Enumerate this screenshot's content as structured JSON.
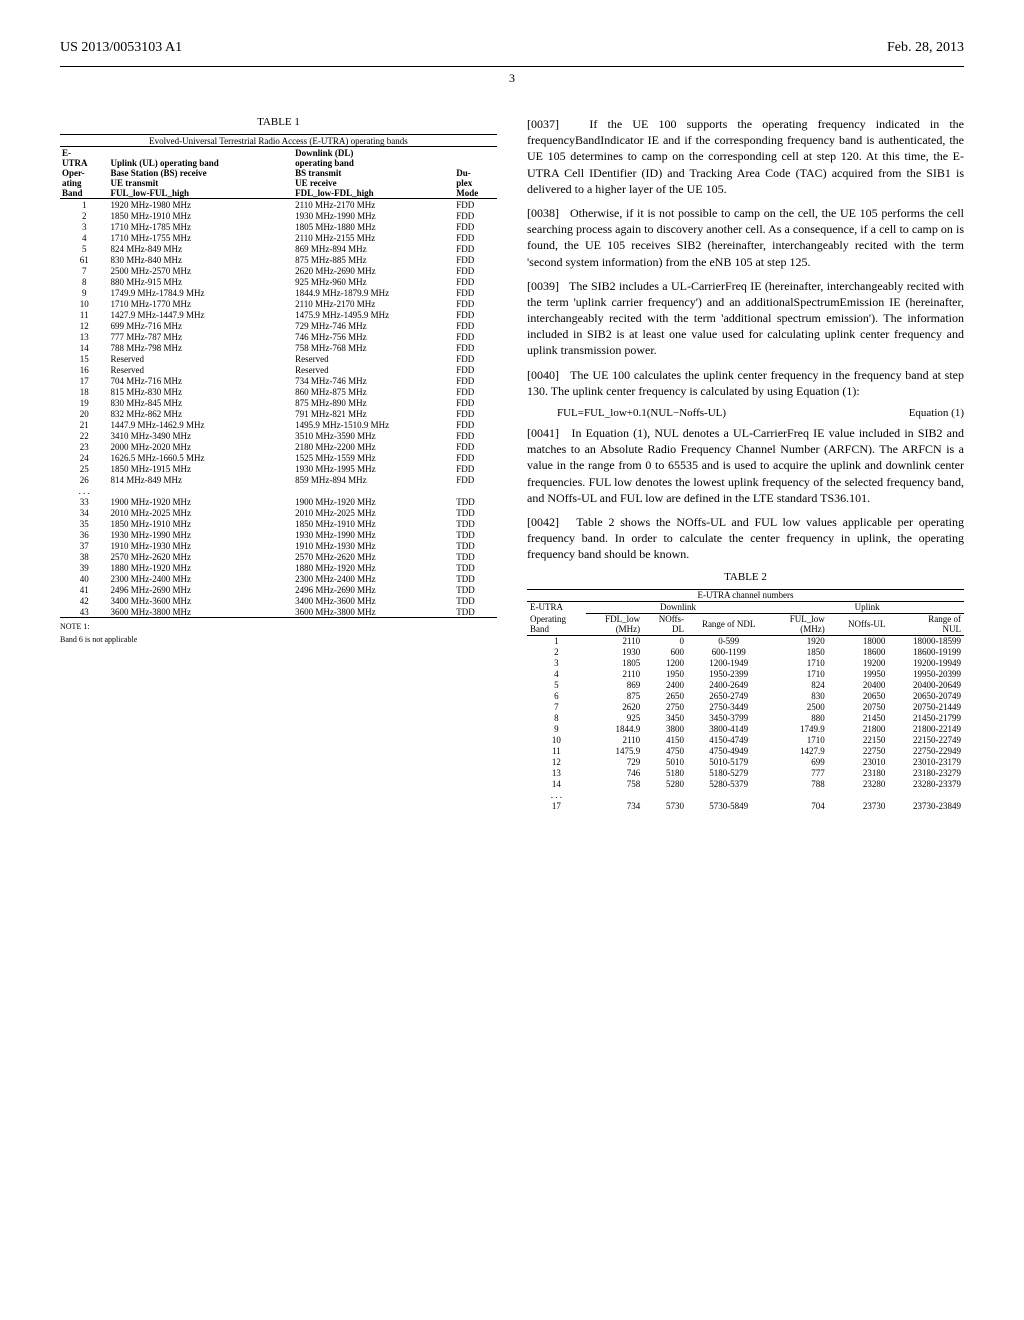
{
  "header": {
    "left": "US 2013/0053103 A1",
    "right": "Feb. 28, 2013"
  },
  "page_number": "3",
  "table1": {
    "title": "TABLE 1",
    "caption": "Evolved-Universal Terrestrial Radio Access (E-UTRA) operating bands",
    "headers": {
      "col1_l1": "E-",
      "col1_l2": "UTRA",
      "col1_l3": "Oper-",
      "col1_l4": "ating",
      "col1_l5": "Band",
      "col2_l1": "Uplink (UL) operating band",
      "col2_l2": "Base Station (BS) receive",
      "col2_l3": "UE transmit",
      "col2_l4": "FUL_low-FUL_high",
      "col3_l1": "Downlink (DL)",
      "col3_l2": "operating band",
      "col3_l3": "BS transmit",
      "col3_l4": "UE receive",
      "col3_l5": "FDL_low-FDL_high",
      "col4_l1": "Du-",
      "col4_l2": "plex",
      "col4_l3": "Mode"
    },
    "rows": [
      {
        "band": "1",
        "ul": "1920 MHz-1980 MHz",
        "dl": "2110 MHz-2170 MHz",
        "mode": "FDD"
      },
      {
        "band": "2",
        "ul": "1850 MHz-1910 MHz",
        "dl": "1930 MHz-1990 MHz",
        "mode": "FDD"
      },
      {
        "band": "3",
        "ul": "1710 MHz-1785 MHz",
        "dl": "1805 MHz-1880 MHz",
        "mode": "FDD"
      },
      {
        "band": "4",
        "ul": "1710 MHz-1755 MHz",
        "dl": "2110 MHz-2155 MHz",
        "mode": "FDD"
      },
      {
        "band": "5",
        "ul": "824 MHz-849 MHz",
        "dl": "869 MHz-894 MHz",
        "mode": "FDD"
      },
      {
        "band": "61",
        "ul": "830 MHz-840 MHz",
        "dl": "875 MHz-885 MHz",
        "mode": "FDD"
      },
      {
        "band": "7",
        "ul": "2500 MHz-2570 MHz",
        "dl": "2620 MHz-2690 MHz",
        "mode": "FDD"
      },
      {
        "band": "8",
        "ul": "880 MHz-915 MHz",
        "dl": "925 MHz-960 MHz",
        "mode": "FDD"
      },
      {
        "band": "9",
        "ul": "1749.9 MHz-1784.9 MHz",
        "dl": "1844.9 MHz-1879.9 MHz",
        "mode": "FDD"
      },
      {
        "band": "10",
        "ul": "1710 MHz-1770 MHz",
        "dl": "2110 MHz-2170 MHz",
        "mode": "FDD"
      },
      {
        "band": "11",
        "ul": "1427.9 MHz-1447.9 MHz",
        "dl": "1475.9 MHz-1495.9 MHz",
        "mode": "FDD"
      },
      {
        "band": "12",
        "ul": "699 MHz-716 MHz",
        "dl": "729 MHz-746 MHz",
        "mode": "FDD"
      },
      {
        "band": "13",
        "ul": "777 MHz-787 MHz",
        "dl": "746 MHz-756 MHz",
        "mode": "FDD"
      },
      {
        "band": "14",
        "ul": "788 MHz-798 MHz",
        "dl": "758 MHz-768 MHz",
        "mode": "FDD"
      },
      {
        "band": "15",
        "ul": "Reserved",
        "dl": "Reserved",
        "mode": "FDD"
      },
      {
        "band": "16",
        "ul": "Reserved",
        "dl": "Reserved",
        "mode": "FDD"
      },
      {
        "band": "17",
        "ul": "704 MHz-716 MHz",
        "dl": "734 MHz-746 MHz",
        "mode": "FDD"
      },
      {
        "band": "18",
        "ul": "815 MHz-830 MHz",
        "dl": "860 MHz-875 MHz",
        "mode": "FDD"
      },
      {
        "band": "19",
        "ul": "830 MHz-845 MHz",
        "dl": "875 MHz-890 MHz",
        "mode": "FDD"
      },
      {
        "band": "20",
        "ul": "832 MHz-862 MHz",
        "dl": "791 MHz-821 MHz",
        "mode": "FDD"
      },
      {
        "band": "21",
        "ul": "1447.9 MHz-1462.9 MHz",
        "dl": "1495.9 MHz-1510.9 MHz",
        "mode": "FDD"
      },
      {
        "band": "22",
        "ul": "3410 MHz-3490 MHz",
        "dl": "3510 MHz-3590 MHz",
        "mode": "FDD"
      },
      {
        "band": "23",
        "ul": "2000 MHz-2020 MHz",
        "dl": "2180 MHz-2200 MHz",
        "mode": "FDD"
      },
      {
        "band": "24",
        "ul": "1626.5 MHz-1660.5 MHz",
        "dl": "1525 MHz-1559 MHz",
        "mode": "FDD"
      },
      {
        "band": "25",
        "ul": "1850 MHz-1915 MHz",
        "dl": "1930 MHz-1995 MHz",
        "mode": "FDD"
      },
      {
        "band": "26",
        "ul": "814 MHz-849 MHz",
        "dl": "859 MHz-894 MHz",
        "mode": "FDD"
      },
      {
        "band": ". . .",
        "ul": "",
        "dl": "",
        "mode": ""
      },
      {
        "band": "33",
        "ul": "1900 MHz-1920 MHz",
        "dl": "1900 MHz-1920 MHz",
        "mode": "TDD"
      },
      {
        "band": "34",
        "ul": "2010 MHz-2025 MHz",
        "dl": "2010 MHz-2025 MHz",
        "mode": "TDD"
      },
      {
        "band": "35",
        "ul": "1850 MHz-1910 MHz",
        "dl": "1850 MHz-1910 MHz",
        "mode": "TDD"
      },
      {
        "band": "36",
        "ul": "1930 MHz-1990 MHz",
        "dl": "1930 MHz-1990 MHz",
        "mode": "TDD"
      },
      {
        "band": "37",
        "ul": "1910 MHz-1930 MHz",
        "dl": "1910 MHz-1930 MHz",
        "mode": "TDD"
      },
      {
        "band": "38",
        "ul": "2570 MHz-2620 MHz",
        "dl": "2570 MHz-2620 MHz",
        "mode": "TDD"
      },
      {
        "band": "39",
        "ul": "1880 MHz-1920 MHz",
        "dl": "1880 MHz-1920 MHz",
        "mode": "TDD"
      },
      {
        "band": "40",
        "ul": "2300 MHz-2400 MHz",
        "dl": "2300 MHz-2400 MHz",
        "mode": "TDD"
      },
      {
        "band": "41",
        "ul": "2496 MHz-2690 MHz",
        "dl": "2496 MHz-2690 MHz",
        "mode": "TDD"
      },
      {
        "band": "42",
        "ul": "3400 MHz-3600 MHz",
        "dl": "3400 MHz-3600 MHz",
        "mode": "TDD"
      },
      {
        "band": "43",
        "ul": "3600 MHz-3800 MHz",
        "dl": "3600 MHz-3800 MHz",
        "mode": "TDD"
      }
    ],
    "note1": "NOTE 1:",
    "note2": "Band 6 is not applicable"
  },
  "paragraphs": {
    "p37_num": "[0037]",
    "p37": "If the UE 100 supports the operating frequency indicated in the frequencyBandIndicator IE and if the corresponding frequency band is authenticated, the UE 105 determines to camp on the corresponding cell at step 120. At this time, the E-UTRA Cell IDentifier (ID) and Tracking Area Code (TAC) acquired from the SIB1 is delivered to a higher layer of the UE 105.",
    "p38_num": "[0038]",
    "p38": "Otherwise, if it is not possible to camp on the cell, the UE 105 performs the cell searching process again to discovery another cell. As a consequence, if a cell to camp on is found, the UE 105 receives SIB2 (hereinafter, interchangeably recited with the term 'second system information) from the eNB 105 at step 125.",
    "p39_num": "[0039]",
    "p39": "The SIB2 includes a UL-CarrierFreq IE (hereinafter, interchangeably recited with the term 'uplink carrier frequency') and an additionalSpectrumEmission IE (hereinafter, interchangeably recited with the term 'additional spectrum emission'). The information included in SIB2 is at least one value used for calculating uplink center frequency and uplink transmission power.",
    "p40_num": "[0040]",
    "p40": "The UE 100 calculates the uplink center frequency in the frequency band at step 130. The uplink center frequency is calculated by using Equation (1):",
    "eq1": "FUL=FUL_low+0.1(NUL−Noffs-UL)",
    "eq1_label": "Equation (1)",
    "p41_num": "[0041]",
    "p41": "In Equation (1), NUL denotes a UL-CarrierFreq IE value included in SIB2 and matches to an Absolute Radio Frequency Channel Number (ARFCN). The ARFCN is a value in the range from 0 to 65535 and is used to acquire the uplink and downlink center frequencies. FUL low denotes the lowest uplink frequency of the selected frequency band, and NOffs-UL and FUL low are defined in the LTE standard TS36.101.",
    "p42_num": "[0042]",
    "p42": "Table 2 shows the NOffs-UL and FUL low values applicable per operating frequency band. In order to calculate the center frequency in uplink, the operating frequency band should be known."
  },
  "table2": {
    "title": "TABLE 2",
    "caption": "E-UTRA channel numbers",
    "headers": {
      "eutra": "E-UTRA",
      "downlink": "Downlink",
      "uplink": "Uplink",
      "opband_l1": "Operating",
      "opband_l2": "Band",
      "fdl_l1": "FDL_low",
      "fdl_l2": "(MHz)",
      "noffs_dl_l1": "NOffs-",
      "noffs_dl_l2": "DL",
      "range_ndl": "Range of NDL",
      "ful_l1": "FUL_low",
      "ful_l2": "(MHz)",
      "noffs_ul": "NOffs-UL",
      "range_nul_l1": "Range of",
      "range_nul_l2": "NUL"
    },
    "rows": [
      {
        "band": "1",
        "fdl": "2110",
        "noffsdl": "0",
        "rndl": "0-599",
        "ful": "1920",
        "noffsul": "18000",
        "rnul": "18000-18599"
      },
      {
        "band": "2",
        "fdl": "1930",
        "noffsdl": "600",
        "rndl": "600-1199",
        "ful": "1850",
        "noffsul": "18600",
        "rnul": "18600-19199"
      },
      {
        "band": "3",
        "fdl": "1805",
        "noffsdl": "1200",
        "rndl": "1200-1949",
        "ful": "1710",
        "noffsul": "19200",
        "rnul": "19200-19949"
      },
      {
        "band": "4",
        "fdl": "2110",
        "noffsdl": "1950",
        "rndl": "1950-2399",
        "ful": "1710",
        "noffsul": "19950",
        "rnul": "19950-20399"
      },
      {
        "band": "5",
        "fdl": "869",
        "noffsdl": "2400",
        "rndl": "2400-2649",
        "ful": "824",
        "noffsul": "20400",
        "rnul": "20400-20649"
      },
      {
        "band": "6",
        "fdl": "875",
        "noffsdl": "2650",
        "rndl": "2650-2749",
        "ful": "830",
        "noffsul": "20650",
        "rnul": "20650-20749"
      },
      {
        "band": "7",
        "fdl": "2620",
        "noffsdl": "2750",
        "rndl": "2750-3449",
        "ful": "2500",
        "noffsul": "20750",
        "rnul": "20750-21449"
      },
      {
        "band": "8",
        "fdl": "925",
        "noffsdl": "3450",
        "rndl": "3450-3799",
        "ful": "880",
        "noffsul": "21450",
        "rnul": "21450-21799"
      },
      {
        "band": "9",
        "fdl": "1844.9",
        "noffsdl": "3800",
        "rndl": "3800-4149",
        "ful": "1749.9",
        "noffsul": "21800",
        "rnul": "21800-22149"
      },
      {
        "band": "10",
        "fdl": "2110",
        "noffsdl": "4150",
        "rndl": "4150-4749",
        "ful": "1710",
        "noffsul": "22150",
        "rnul": "22150-22749"
      },
      {
        "band": "11",
        "fdl": "1475.9",
        "noffsdl": "4750",
        "rndl": "4750-4949",
        "ful": "1427.9",
        "noffsul": "22750",
        "rnul": "22750-22949"
      },
      {
        "band": "12",
        "fdl": "729",
        "noffsdl": "5010",
        "rndl": "5010-5179",
        "ful": "699",
        "noffsul": "23010",
        "rnul": "23010-23179"
      },
      {
        "band": "13",
        "fdl": "746",
        "noffsdl": "5180",
        "rndl": "5180-5279",
        "ful": "777",
        "noffsul": "23180",
        "rnul": "23180-23279"
      },
      {
        "band": "14",
        "fdl": "758",
        "noffsdl": "5280",
        "rndl": "5280-5379",
        "ful": "788",
        "noffsul": "23280",
        "rnul": "23280-23379"
      },
      {
        "band": ". . .",
        "fdl": "",
        "noffsdl": "",
        "rndl": "",
        "ful": "",
        "noffsul": "",
        "rnul": ""
      },
      {
        "band": "17",
        "fdl": "734",
        "noffsdl": "5730",
        "rndl": "5730-5849",
        "ful": "704",
        "noffsul": "23730",
        "rnul": "23730-23849"
      }
    ]
  }
}
